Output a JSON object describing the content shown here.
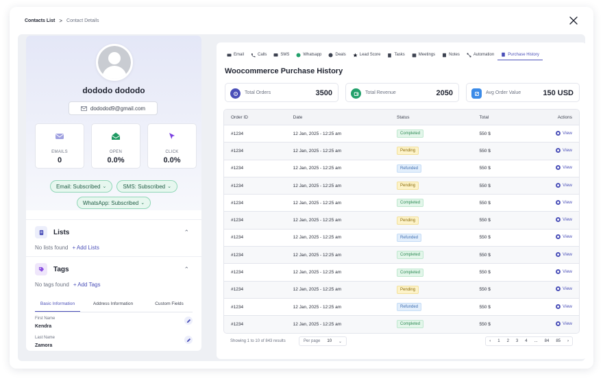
{
  "breadcrumb": {
    "parent": "Contacts List",
    "separator": ">",
    "current": "Contact Details"
  },
  "contact": {
    "name": "dododo dododo",
    "email": "dododod9@gmail.com",
    "stats": [
      {
        "label": "EMAILS",
        "value": "0",
        "icon": "envelope-icon",
        "color": "#8e8fd8"
      },
      {
        "label": "OPEN",
        "value": "0.0%",
        "icon": "open-envelope-icon",
        "color": "#22a06b"
      },
      {
        "label": "CLICK",
        "value": "0.0%",
        "icon": "cursor-click-icon",
        "color": "#7a3fe0"
      }
    ],
    "subscriptions": [
      {
        "label": "Email: Subscribed"
      },
      {
        "label": "SMS: Subscribed"
      },
      {
        "label": "WhatsApp: Subscribed"
      }
    ]
  },
  "lists": {
    "title": "Lists",
    "empty": "No lists found",
    "add": "+ Add Lists"
  },
  "tags": {
    "title": "Tags",
    "empty": "No tags found",
    "add": "+ Add Tags"
  },
  "info_tabs": [
    {
      "label": "Basic Information",
      "active": true
    },
    {
      "label": "Address Information",
      "active": false
    },
    {
      "label": "Custom Fields",
      "active": false
    }
  ],
  "fields": [
    {
      "label": "First Name",
      "value": "Kendra"
    },
    {
      "label": "Last  Name",
      "value": "Zamora"
    }
  ],
  "tabs": [
    {
      "label": "Email",
      "icon": "envelope-icon"
    },
    {
      "label": "Calls",
      "icon": "phone-icon"
    },
    {
      "label": "SMS",
      "icon": "sms-icon"
    },
    {
      "label": "Whatsapp",
      "icon": "whatsapp-icon"
    },
    {
      "label": "Deals",
      "icon": "deals-icon"
    },
    {
      "label": "Lead Score",
      "icon": "star-icon"
    },
    {
      "label": "Tasks",
      "icon": "clipboard-icon"
    },
    {
      "label": "Meetings",
      "icon": "calendar-icon"
    },
    {
      "label": "Notes",
      "icon": "notes-icon"
    },
    {
      "label": "Automation",
      "icon": "automation-icon"
    },
    {
      "label": "Purchase History",
      "icon": "receipt-icon",
      "active": true
    }
  ],
  "purchase": {
    "title": "Woocommerce Purchase History",
    "metrics": [
      {
        "label": "Total Orders",
        "value": "3500",
        "icon": "orders-icon",
        "color": "#4a4fb8"
      },
      {
        "label": "Total Revenue",
        "value": "2050",
        "icon": "revenue-icon",
        "color": "#22a06b"
      },
      {
        "label": "Avg Order Value",
        "value": "150 USD",
        "icon": "avg-icon",
        "color": "#3b8be8"
      }
    ],
    "columns": {
      "id": "Order ID",
      "date": "Date",
      "status": "Status",
      "total": "Total",
      "actions": "Actions"
    },
    "rows": [
      {
        "id": "#1234",
        "date": "12 Jan, 2025 - 12:25 am",
        "status": "Completed",
        "total": "550 $",
        "action": "View"
      },
      {
        "id": "#1234",
        "date": "12 Jan, 2025 - 12:25 am",
        "status": "Pending",
        "total": "550 $",
        "action": "View"
      },
      {
        "id": "#1234",
        "date": "12 Jan, 2025 - 12:25 am",
        "status": "Refunded",
        "total": "550 $",
        "action": "View"
      },
      {
        "id": "#1234",
        "date": "12 Jan, 2025 - 12:25 am",
        "status": "Pending",
        "total": "550 $",
        "action": "View"
      },
      {
        "id": "#1234",
        "date": "12 Jan, 2025 - 12:25 am",
        "status": "Completed",
        "total": "550 $",
        "action": "View"
      },
      {
        "id": "#1234",
        "date": "12 Jan, 2025 - 12:25 am",
        "status": "Pending",
        "total": "550 $",
        "action": "View"
      },
      {
        "id": "#1234",
        "date": "12 Jan, 2025 - 12:25 am",
        "status": "Refunded",
        "total": "550 $",
        "action": "View"
      },
      {
        "id": "#1234",
        "date": "12 Jan, 2025 - 12:25 am",
        "status": "Completed",
        "total": "550 $",
        "action": "View"
      },
      {
        "id": "#1234",
        "date": "12 Jan, 2025 - 12:25 am",
        "status": "Completed",
        "total": "550 $",
        "action": "View"
      },
      {
        "id": "#1234",
        "date": "12 Jan, 2025 - 12:25 am",
        "status": "Pending",
        "total": "550 $",
        "action": "View"
      },
      {
        "id": "#1234",
        "date": "12 Jan, 2025 - 12:25 am",
        "status": "Refunded",
        "total": "550 $",
        "action": "View"
      },
      {
        "id": "#1234",
        "date": "12 Jan, 2025 - 12:25 am",
        "status": "Completed",
        "total": "550 $",
        "action": "View"
      }
    ],
    "footer": {
      "showing": "Showing 1 to 10 of 843 results",
      "per_page_label": "Per page",
      "per_page_value": "10",
      "pages": [
        "1",
        "2",
        "3",
        "4",
        "...",
        "84",
        "85"
      ]
    }
  }
}
